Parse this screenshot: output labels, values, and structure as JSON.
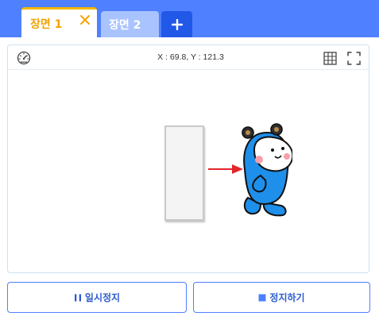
{
  "tabs": [
    {
      "label": "장면 1",
      "active": true,
      "close_icon": "close-icon"
    },
    {
      "label": "장면 2",
      "active": false
    }
  ],
  "add_tab_icon": "plus-icon",
  "toolbar": {
    "speed_icon": "speedometer-icon",
    "coordinates": "X : 69.8, Y : 121.3",
    "grid_icon": "grid-icon",
    "fullscreen_icon": "fullscreen-icon"
  },
  "buttons": {
    "pause": {
      "label": "일시정지",
      "icon": "pause-icon"
    },
    "stop": {
      "label": "정지하기",
      "icon": "stop-icon"
    }
  },
  "colors": {
    "accent": "#4f80ff",
    "active_tab_text": "#f5a300",
    "arrow": "#e3242b",
    "character_blue": "#1e8fea"
  }
}
